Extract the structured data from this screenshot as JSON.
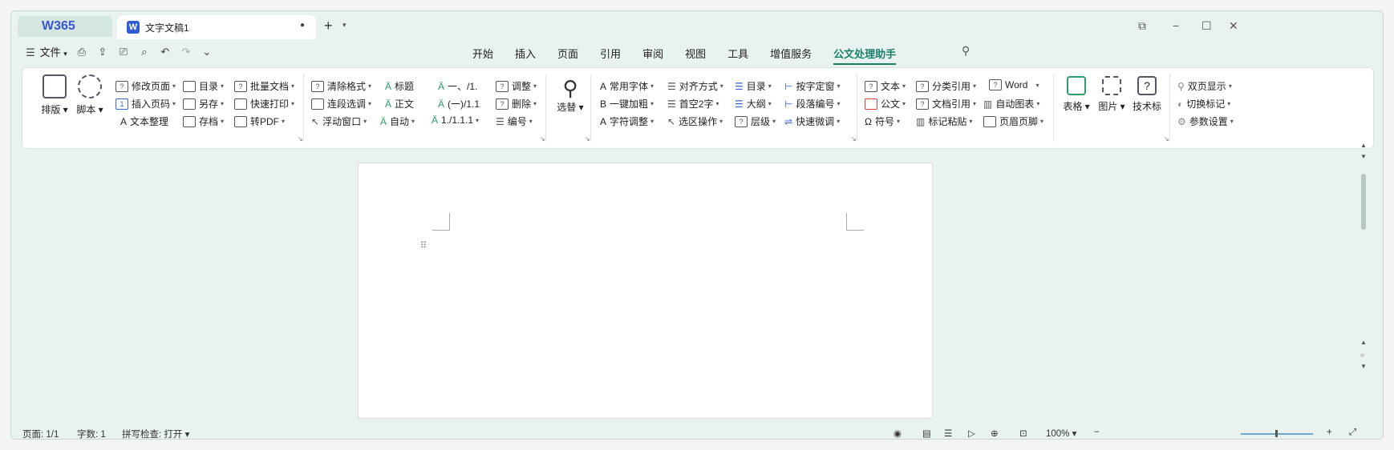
{
  "titlebar": {
    "logo": "W365",
    "doc_tab": "文字文稿1",
    "close_tab": "●",
    "new_tab": "+",
    "win_restore": "⧉",
    "win_min": "−",
    "win_max": "☐",
    "win_close": "✕"
  },
  "menu": {
    "file": "文件",
    "tabs": [
      "开始",
      "插入",
      "页面",
      "引用",
      "审阅",
      "视图",
      "工具",
      "增值服务",
      "公文处理助手"
    ],
    "active_tab": "公文处理助手"
  },
  "ribbon": {
    "g1": {
      "layout": "排版",
      "script": "脚本",
      "items": [
        "修改页面",
        "插入页码",
        "文本整理",
        "目录",
        "另存",
        "存档",
        "批量文档",
        "快速打印",
        "转PDF"
      ]
    },
    "g2": {
      "items": [
        "清除格式",
        "连段选调",
        "浮动窗口",
        "标题",
        "正文",
        "自动",
        "一、/1.",
        "(一)/1.1",
        "1./1.1.1",
        "调整",
        "删除",
        "编号"
      ]
    },
    "g3": {
      "replace": "选替"
    },
    "g4": {
      "items": [
        "常用字体",
        "一键加粗",
        "字符调整",
        "对齐方式",
        "首空2字",
        "选区操作",
        "目录",
        "大纲",
        "层级",
        "按字定窗",
        "段落编号",
        "快速微调"
      ]
    },
    "g5": {
      "items": [
        "文本",
        "公文",
        "符号",
        "分类引用",
        "文档引用",
        "标记粘贴",
        "Word",
        "自动图表",
        "页眉页脚"
      ]
    },
    "g6": {
      "items": [
        "表格",
        "图片",
        "技术标"
      ]
    },
    "g7": {
      "items": [
        "双页显示",
        "切换标记",
        "参数设置"
      ]
    }
  },
  "status": {
    "page": "页面: 1/1",
    "words": "字数: 1",
    "spell": "拼写检查: 打开",
    "zoom": "100%"
  }
}
